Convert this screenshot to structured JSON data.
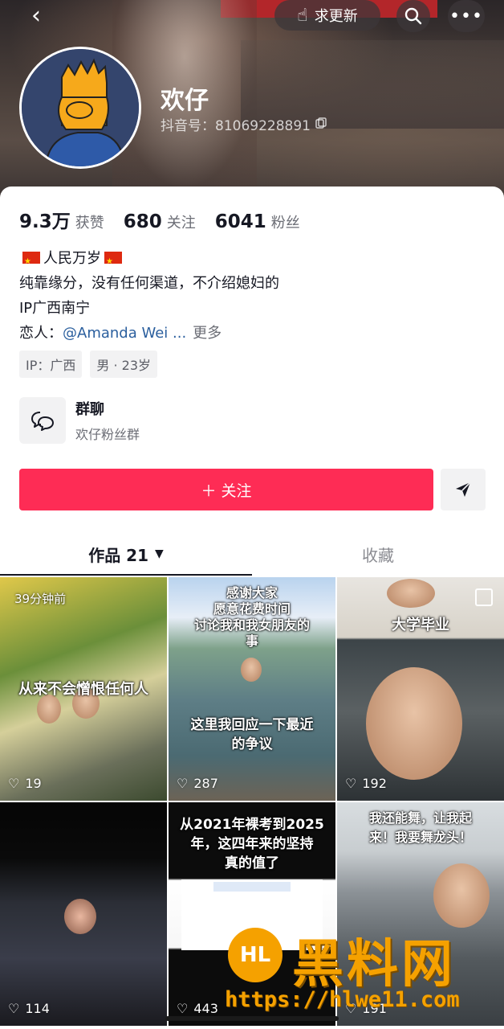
{
  "header": {
    "update_label": "求更新",
    "nickname": "欢仔",
    "douyin_id": "抖音号：81069228891"
  },
  "stats": [
    {
      "value": "9.3万",
      "label": "获赞"
    },
    {
      "value": "680",
      "label": "关注"
    },
    {
      "value": "6041",
      "label": "粉丝"
    }
  ],
  "bio": {
    "line1": "人民万岁",
    "line2": "纯靠缘分，没有任何渠道，不介绍媳妇的",
    "line3": "IP广西南宁",
    "lover_label": "恋人：",
    "lover_mention": "@Amanda Wei ...",
    "more": "更多"
  },
  "tags": [
    "IP：广西",
    "男 · 23岁"
  ],
  "group": {
    "title": "群聊",
    "subtitle": "欢仔粉丝群"
  },
  "follow_label": "＋ 关注",
  "tabs": {
    "works_label": "作品 21",
    "collect_label": "收藏"
  },
  "videos": [
    {
      "time": "39分钟前",
      "caption": "从来不会憎恨任何人",
      "likes": "19"
    },
    {
      "caption": "感谢大家\n愿意花费时间\n讨论我和我女朋友的\n事",
      "caption2": "这里我回应一下最近\n的争议",
      "likes": "287"
    },
    {
      "caption": "大学毕业",
      "likes": "192"
    },
    {
      "likes": "114"
    },
    {
      "caption": "从2021年裸考到2025\n年，这四年来的坚持\n真的值了",
      "likes": "443"
    },
    {
      "caption": "我还能舞，让我起\n来！我要舞龙头！",
      "likes": "191"
    }
  ],
  "watermark": {
    "logo": "HL",
    "title": "黑料网",
    "url": "https://hlwe11.com"
  },
  "colors": {
    "follow": "#fe2c55",
    "mention": "#2b5f9e",
    "watermark": "#f5a100"
  }
}
